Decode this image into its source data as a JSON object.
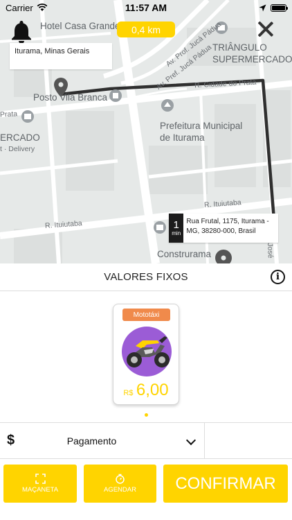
{
  "status_bar": {
    "carrier": "Carrier",
    "time": "11:57 AM"
  },
  "map": {
    "distance": "0,4 km",
    "origin_address": "Iturama, Minas Gerais",
    "destination": {
      "minutes": "1",
      "unit": "min",
      "address": "Rua Frutal, 1175, Iturama - MG, 38280-000, Brasil"
    },
    "labels": {
      "hotel": "Hotel Casa Grande",
      "av_juca_1": "Av. Prof. Jucá Pádua",
      "av_juca_2": "Av. Pref. Jucá Pádua",
      "triangulo_1": "TRIÂNGULO",
      "triangulo_2": "SUPERMERCADO",
      "posto": "Posto Vila Branca",
      "cidade_prata": "R. Cidade do Prata",
      "prata_left": "Prata",
      "prefeitura_1": "Prefeitura Municipal",
      "prefeitura_2": "de Iturama",
      "mercado": "ERCADO",
      "delivery": "t · Delivery",
      "ituiutaba_right": "R. Ituiutaba",
      "ituiutaba_left": "R. Ituiutaba",
      "construrama": "Construrama",
      "jose": "José"
    }
  },
  "sheet": {
    "title": "VALORES FIXOS",
    "fare": {
      "category": "Mototáxi",
      "currency": "R$",
      "price": "6,00",
      "icon": "motorcycle-icon"
    },
    "payment_label": "Pagamento",
    "buttons": {
      "macaneta": "MAÇANETA",
      "agendar": "AGENDAR",
      "confirm": "CONFIRMAR"
    }
  },
  "colors": {
    "accent": "#ffd400",
    "tag": "#f08a4b",
    "bike_purple": "#9b5cd6"
  }
}
